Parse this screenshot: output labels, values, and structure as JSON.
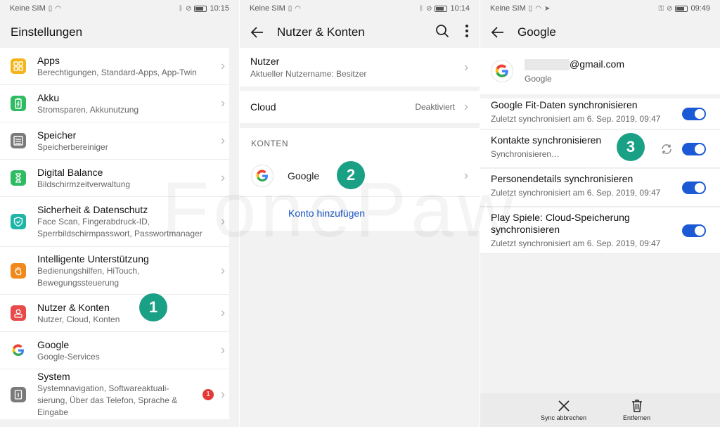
{
  "colors": {
    "accent": "#1b5ad4",
    "badge": "#1aa085",
    "link": "#1a56c8",
    "alert": "#e53935"
  },
  "panel1": {
    "status": {
      "carrier": "Keine SIM",
      "time": "10:15"
    },
    "title": "Einstellungen",
    "items": [
      {
        "label": "Apps",
        "sub": [
          "Berechtigungen, Standard-Apps, App-Twin"
        ],
        "icon": "apps-icon",
        "color": "#f5b51a"
      },
      {
        "label": "Akku",
        "sub": [
          "Stromsparen, Akkunutzung"
        ],
        "icon": "battery-icon",
        "color": "#2fbb61"
      },
      {
        "label": "Speicher",
        "sub": [
          "Speicherbereiniger"
        ],
        "icon": "storage-icon",
        "color": "#7a7a7a"
      },
      {
        "label": "Digital Balance",
        "sub": [
          "Bildschirmzeitverwaltung"
        ],
        "icon": "hourglass-icon",
        "color": "#2fbb61"
      },
      {
        "label": "Sicherheit & Datenschutz",
        "sub": [
          "Face Scan, Fingerabdruck-ID,",
          "Sperrbildschirmpasswort, Passwortmanager"
        ],
        "icon": "shield-icon",
        "color": "#1fb5a8"
      },
      {
        "label": "Intelligente Unterstützung",
        "sub": [
          "Bedienungshilfen, HiTouch,",
          "Bewegungssteuerung"
        ],
        "icon": "hand-icon",
        "color": "#f08a1c"
      },
      {
        "label": "Nutzer & Konten",
        "sub": [
          "Nutzer, Cloud, Konten"
        ],
        "icon": "user-icon",
        "color": "#e84a4a"
      },
      {
        "label": "Google",
        "sub": [
          "Google-Services"
        ],
        "icon": "google-icon",
        "color": "#ffffff"
      },
      {
        "label": "System",
        "sub": [
          "Systemnavigation, Softwareaktuali-",
          "sierung, Über das Telefon, Sprache &",
          "Eingabe"
        ],
        "icon": "system-icon",
        "color": "#7a7a7a"
      }
    ],
    "step_badge": "1",
    "system_badge": "1"
  },
  "panel2": {
    "status": {
      "carrier": "Keine SIM",
      "time": "10:14"
    },
    "title": "Nutzer & Konten",
    "nutzer": {
      "label": "Nutzer",
      "sub": "Aktueller Nutzername: Besitzer"
    },
    "cloud": {
      "label": "Cloud",
      "value": "Deaktiviert"
    },
    "section": "KONTEN",
    "google": {
      "label": "Google"
    },
    "add_account": "Konto hinzufügen",
    "step_badge": "2"
  },
  "panel3": {
    "status": {
      "carrier": "Keine SIM",
      "time": "09:49"
    },
    "title": "Google",
    "account": {
      "email_suffix": "@gmail.com",
      "provider": "Google"
    },
    "sync_items": [
      {
        "label": [
          "Google Fit-Daten synchronisieren"
        ],
        "sub": "Zuletzt synchronisiert am 6. Sep. 2019, 09:47",
        "on": true
      },
      {
        "label": [
          "Kontakte synchronisieren"
        ],
        "sub": "Synchronisieren…",
        "on": true
      },
      {
        "label": [
          "Personendetails synchronisieren"
        ],
        "sub": "Zuletzt synchronisiert am 6. Sep. 2019, 09:47",
        "on": true
      },
      {
        "label": [
          "Play Spiele: Cloud-Speicherung",
          "synchronisieren"
        ],
        "sub": "Zuletzt synchronisiert am 6. Sep. 2019, 09:47",
        "on": true
      }
    ],
    "step_badge": "3",
    "bottom": {
      "cancel_sync": "Sync abbrechen",
      "remove": "Entfernen"
    }
  },
  "watermark": "FonePaw"
}
